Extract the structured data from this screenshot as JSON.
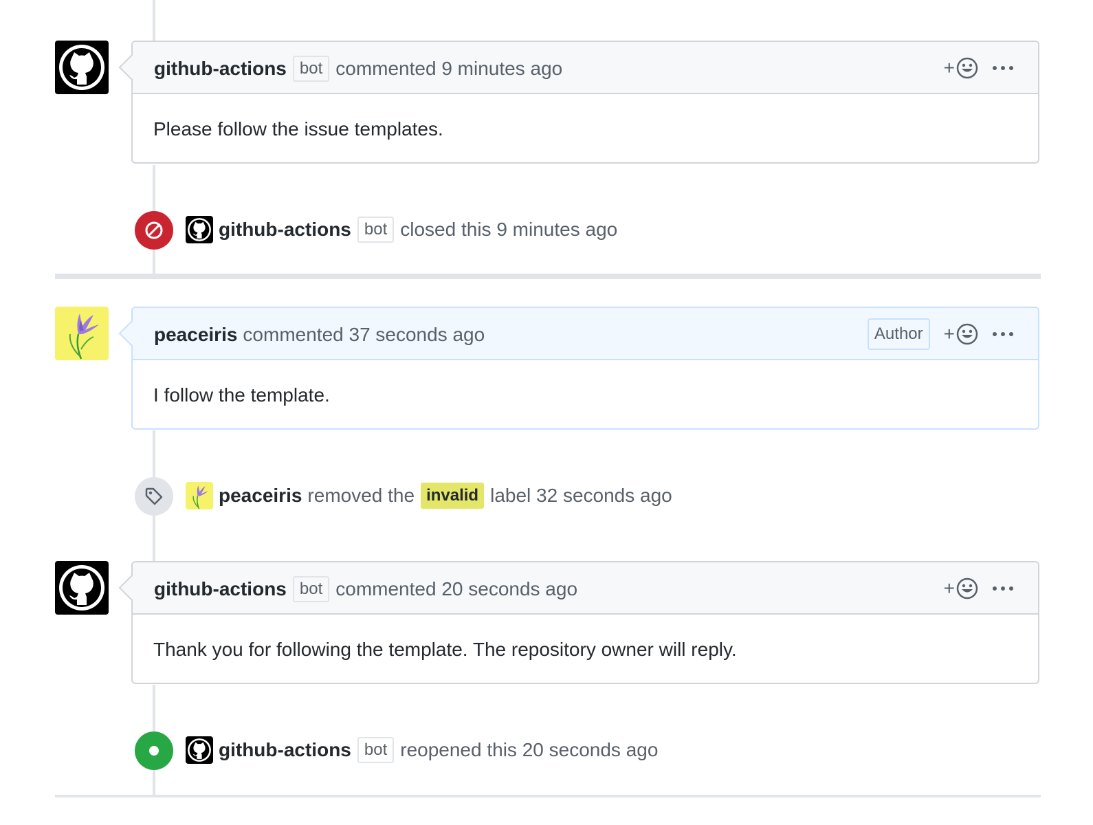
{
  "timeline": [
    {
      "type": "comment",
      "author": "github-actions",
      "bot_label": "bot",
      "action_text": "commented 9 minutes ago",
      "body": "Please follow the issue templates.",
      "reaction_icon": "smiley-icon",
      "more_icon": "kebab-horizontal-icon"
    },
    {
      "type": "event",
      "event_icon": "circle-slash-icon",
      "event_color": "#cb2431",
      "actor": "github-actions",
      "bot_label": "bot",
      "text": "closed this 9 minutes ago"
    },
    {
      "type": "comment",
      "author": "peaceiris",
      "action_text": "commented 37 seconds ago",
      "author_badge": "Author",
      "body": "I follow the template.",
      "reaction_icon": "smiley-icon",
      "more_icon": "kebab-horizontal-icon"
    },
    {
      "type": "event",
      "event_icon": "tag-icon",
      "actor": "peaceiris",
      "text_before": "removed the",
      "label": "invalid",
      "label_color": "#e4e669",
      "text_after": "label 32 seconds ago"
    },
    {
      "type": "comment",
      "author": "github-actions",
      "bot_label": "bot",
      "action_text": "commented 20 seconds ago",
      "body": "Thank you for following the template. The repository owner will reply.",
      "reaction_icon": "smiley-icon",
      "more_icon": "kebab-horizontal-icon"
    },
    {
      "type": "event",
      "event_icon": "dot-fill-icon",
      "event_color": "#28a745",
      "actor": "github-actions",
      "bot_label": "bot",
      "text": "reopened this 20 seconds ago"
    }
  ],
  "reaction_plus": "+"
}
